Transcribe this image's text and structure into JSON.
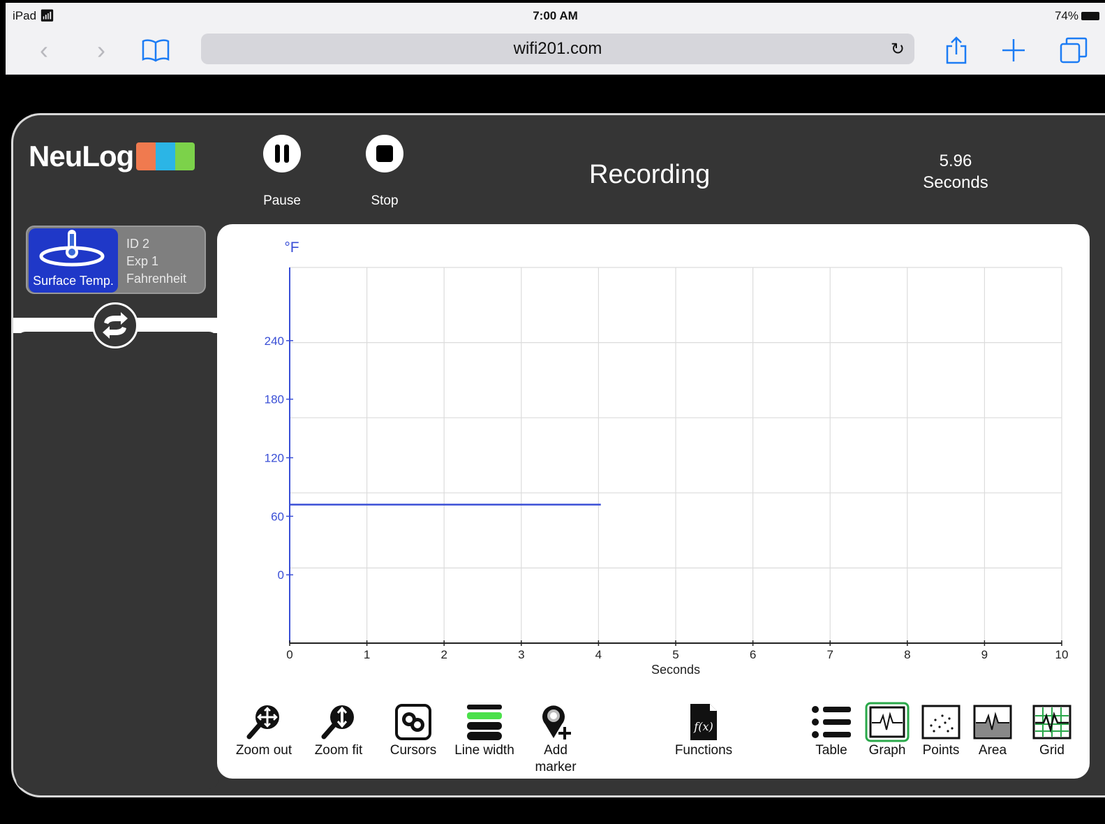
{
  "status_bar": {
    "device": "iPad",
    "time": "7:00 AM",
    "battery": "74%"
  },
  "browser": {
    "url": "wifi201.com"
  },
  "app": {
    "logo_text": "NeuLog",
    "controls": {
      "pause_label": "Pause",
      "stop_label": "Stop"
    },
    "status_title": "Recording",
    "timer": {
      "value": "5.96",
      "unit": "Seconds"
    }
  },
  "sensor": {
    "name": "Surface Temp.",
    "id": "ID 2",
    "exp": "Exp 1",
    "unit": "Fahrenheit"
  },
  "chart_data": {
    "type": "line",
    "ylabel": "°F",
    "xlabel": "Seconds",
    "xlim": [
      0,
      10
    ],
    "ylim": [
      -70,
      315
    ],
    "x_ticks": [
      0,
      1,
      2,
      3,
      4,
      5,
      6,
      7,
      8,
      9,
      10
    ],
    "y_ticks": [
      0,
      60,
      120,
      180,
      240
    ],
    "grid": true,
    "series": [
      {
        "color": "#3a4fd6",
        "x": [
          0,
          4.03
        ],
        "y": [
          72,
          72
        ]
      }
    ]
  },
  "toolbar": {
    "zoom_out": "Zoom out",
    "zoom_fit": "Zoom fit",
    "cursors": "Cursors",
    "line_width": "Line width",
    "add_marker_1": "Add",
    "add_marker_2": "marker",
    "functions": "Functions",
    "table": "Table",
    "graph": "Graph",
    "points": "Points",
    "area": "Area",
    "grid": "Grid"
  },
  "colors": {
    "accent_blue": "#1f38c8",
    "plot_blue": "#3a4fd6",
    "selected_green": "#2aa84a"
  }
}
